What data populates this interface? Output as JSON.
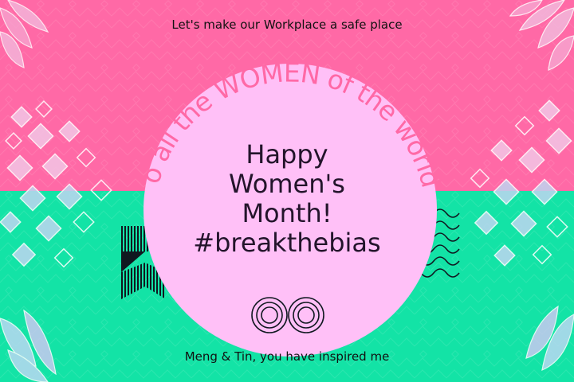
{
  "card": {
    "top_caption": "Let's make our Workplace a safe place",
    "arc_text": "To all the WOMEN of the world,",
    "headline": {
      "line1": "Happy",
      "line2": "Women's",
      "line3": "Month!",
      "line4": "#breakthebias"
    },
    "bottom_caption": "Meng & Tin, you have inspired me"
  },
  "colors": {
    "top_band": "#ff69a6",
    "bottom_band": "#13e3a6",
    "circle": "#ffc0f7",
    "arc_text": "#ff69a6",
    "headline": "#23142b"
  },
  "decorations": {
    "corner_flowers": "lotus-flower-icon",
    "diamond_grid": "diamond-pattern-icon",
    "waves": "wave-lines-icon",
    "double_circle": "concentric-circles-icon",
    "striped_shape": "striped-hourglass-icon"
  }
}
